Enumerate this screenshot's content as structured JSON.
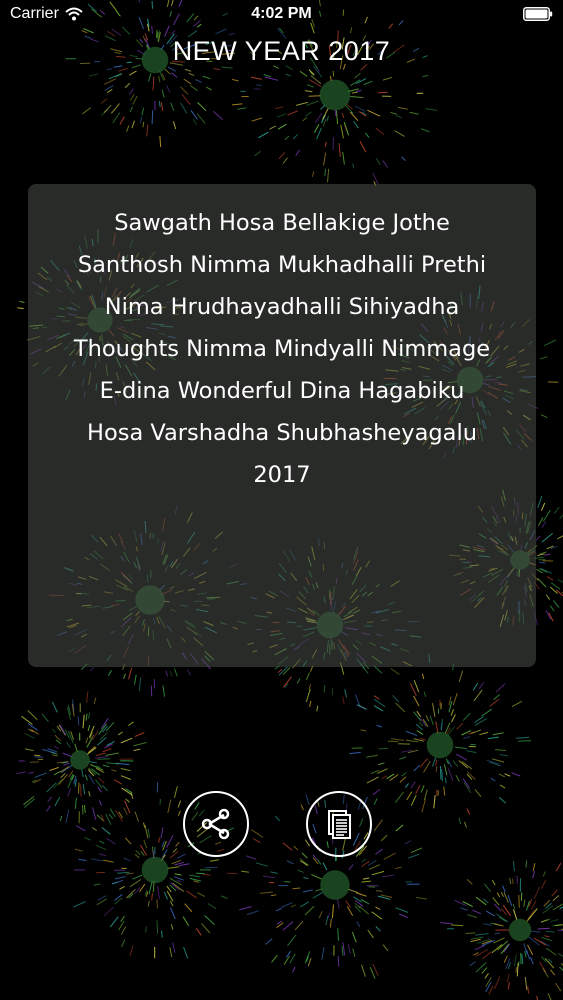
{
  "status_bar": {
    "carrier": "Carrier",
    "time": "4:02 PM"
  },
  "header": {
    "title": "NEW YEAR 2017"
  },
  "message": {
    "text": "Sawgath Hosa Bellakige Jothe\nSanthosh Nimma Mukhadhalli Prethi\nNima Hrudhayadhalli Sihiyadha\nThoughts Nimma Mindyalli Nimmage\nE-dina Wonderful Dina Hagabiku\nHosa Varshadha Shubhasheyagalu\n2017"
  },
  "actions": {
    "share_icon": "share-icon",
    "copy_icon": "copy-icon"
  },
  "colors": {
    "background": "#000000",
    "text": "#ffffff",
    "card": "#484e48"
  }
}
